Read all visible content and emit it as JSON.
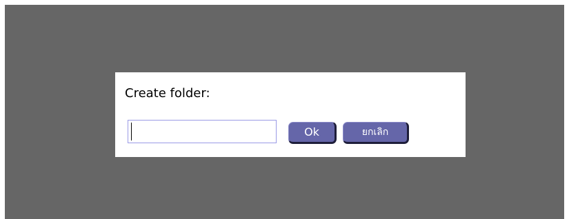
{
  "dialog": {
    "title": "Create folder:",
    "input": {
      "value": "",
      "placeholder": ""
    },
    "ok_label": "Ok",
    "cancel_label": "ยกเลิก"
  },
  "colors": {
    "overlay": "#666666",
    "button": "#6566a9",
    "input_border": "#9a9ae6"
  }
}
